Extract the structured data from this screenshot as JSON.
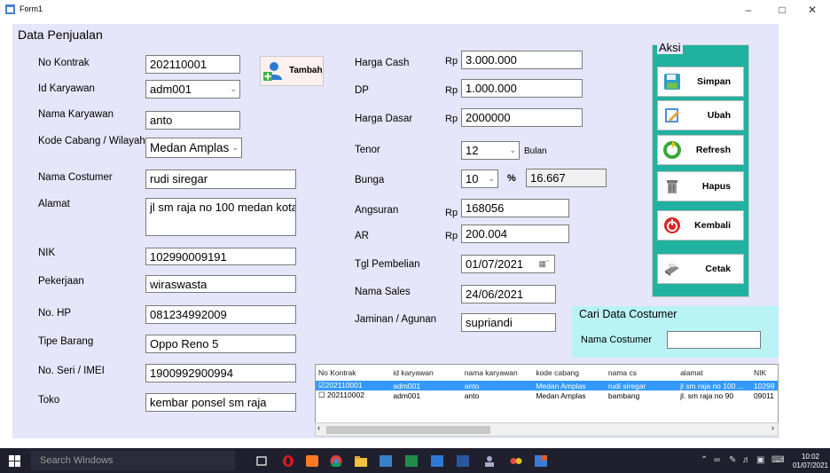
{
  "window": {
    "title": "Form1",
    "min_glyph": "–",
    "max_glyph": "□",
    "close_glyph": "✕"
  },
  "form": {
    "group_title": "Data Penjualan",
    "labels": {
      "no_kontrak": "No Kontrak",
      "id_karyawan": "Id Karyawan",
      "nama_karyawan": "Nama Karyawan",
      "kode_cabang": "Kode Cabang / Wilayah",
      "nama_costumer": "Nama Costumer",
      "alamat": "Alamat",
      "nik": "NIK",
      "pekerjaan": "Pekerjaan",
      "no_hp": "No. HP",
      "tipe_barang": "Tipe Barang",
      "no_seri": "No. Seri / IMEI",
      "toko": "Toko",
      "harga_cash": "Harga Cash",
      "dp": "DP",
      "harga_dasar": "Harga Dasar",
      "tenor": "Tenor",
      "bunga": "Bunga",
      "angsuran": "Angsuran",
      "ar": "AR",
      "tgl_pembelian": "Tgl Pembelian",
      "nama_sales": "Nama Sales",
      "jaminan": "Jaminan / Agunan"
    },
    "values": {
      "no_kontrak": "202110001",
      "id_karyawan": "adm001",
      "nama_karyawan": "anto",
      "kode_cabang": "Medan Amplas",
      "nama_costumer": "rudi siregar",
      "alamat": "jl sm raja no 100 medan kota",
      "nik": "102990009191",
      "pekerjaan": "wiraswasta",
      "no_hp": "081234992009",
      "tipe_barang": "Oppo Reno 5",
      "no_seri": "1900992900994",
      "toko": "kembar ponsel sm raja",
      "harga_cash": "3.000.000",
      "dp": "1.000.000",
      "harga_dasar": "2000000",
      "tenor": "12",
      "tenor_unit": "Bulan",
      "bunga": "10",
      "bunga_unit": "%",
      "bunga_result": "16.667",
      "angsuran": "168056",
      "ar": "200.004",
      "tgl_pembelian": "01/07/2021",
      "nama_sales": "24/06/2021",
      "jaminan": "supriandi"
    },
    "currency": "Rp",
    "tambah_label": "Tambah"
  },
  "aksi": {
    "title": "Aksi",
    "buttons": [
      "Simpan",
      "Ubah",
      "Refresh",
      "Hapus",
      "Kembali",
      "Cetak"
    ]
  },
  "cari": {
    "title": "Cari Data Costumer",
    "label": "Nama Costumer",
    "value": ""
  },
  "grid": {
    "columns": [
      "No Kontrak",
      "id karyawan",
      "nama karyawan",
      "kode cabang",
      "nama cs",
      "alamat",
      "NIK"
    ],
    "rows": [
      {
        "checked": true,
        "selected": true,
        "cells": [
          "202110001",
          "adm001",
          "anto",
          "Medan Amplas",
          "rudi siregar",
          "jl sm raja no 100 ...",
          "10299"
        ]
      },
      {
        "checked": false,
        "selected": false,
        "cells": [
          "202110002",
          "adm001",
          "anto",
          "Medan Amplas",
          "bambang",
          "jl. sm raja no 90",
          "09011"
        ]
      }
    ]
  },
  "taskbar": {
    "search_placeholder": "Search Windows",
    "time": "10:02",
    "date": "01/07/2021"
  },
  "colors": {
    "form_bg": "#e6e6fa",
    "aksi_bg": "#20b2a0",
    "cari_bg": "#b9f3f3",
    "selection": "#3399ff",
    "taskbar": "#1f1f2e"
  }
}
